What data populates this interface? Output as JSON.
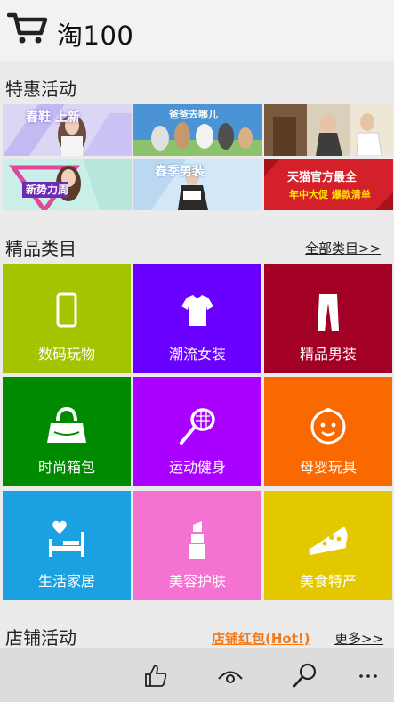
{
  "app": {
    "title": "淘100",
    "logo_icon": "shopping-cart-icon"
  },
  "promotions": {
    "title": "特惠活动",
    "banners": [
      {
        "text": "春鞋  上新",
        "color": "#c9c2f0",
        "accent": "#ffffff"
      },
      {
        "text": "爸爸去哪儿",
        "color": "#6aa7d9",
        "accent": "#ffffff"
      },
      {
        "text": "",
        "color": "#ddd4c2",
        "accent": "#333333"
      },
      {
        "text": "新势力周",
        "color": "#c7efe8",
        "accent": "#ffffff"
      },
      {
        "text": "春季男装",
        "color": "#cfe4f6",
        "accent": "#ffffff"
      },
      {
        "text": "天猫官方最全",
        "text2": "年中大促 爆款清单",
        "color": "#d3202a",
        "accent": "#ffe400"
      }
    ]
  },
  "categories": {
    "title": "精品类目",
    "all_link": "全部类目>>",
    "tiles": [
      {
        "label": "数码玩物",
        "icon": "smartphone-icon",
        "color": "#a4c400"
      },
      {
        "label": "潮流女装",
        "icon": "blouse-icon",
        "color": "#6a00ff"
      },
      {
        "label": "精品男装",
        "icon": "trousers-icon",
        "color": "#a20025"
      },
      {
        "label": "时尚箱包",
        "icon": "handbag-icon",
        "color": "#008a00"
      },
      {
        "label": "运动健身",
        "icon": "tennis-racket-icon",
        "color": "#aa00ff"
      },
      {
        "label": "母婴玩具",
        "icon": "baby-face-icon",
        "color": "#fa6800"
      },
      {
        "label": "生活家居",
        "icon": "bed-heart-icon",
        "color": "#1ba1e2"
      },
      {
        "label": "美容护肤",
        "icon": "lipstick-icon",
        "color": "#f472d0"
      },
      {
        "label": "美食特产",
        "icon": "pizza-icon",
        "color": "#e3c800"
      }
    ]
  },
  "shops": {
    "title": "店铺活动",
    "hot_link": "店铺红包(Hot!)",
    "more_link": "更多>>",
    "hot_color": "#f07a1c"
  },
  "appbar": {
    "buttons": [
      {
        "icon": "thumbs-up-icon"
      },
      {
        "icon": "eye-icon"
      },
      {
        "icon": "search-icon"
      },
      {
        "icon": "more-icon"
      }
    ]
  }
}
